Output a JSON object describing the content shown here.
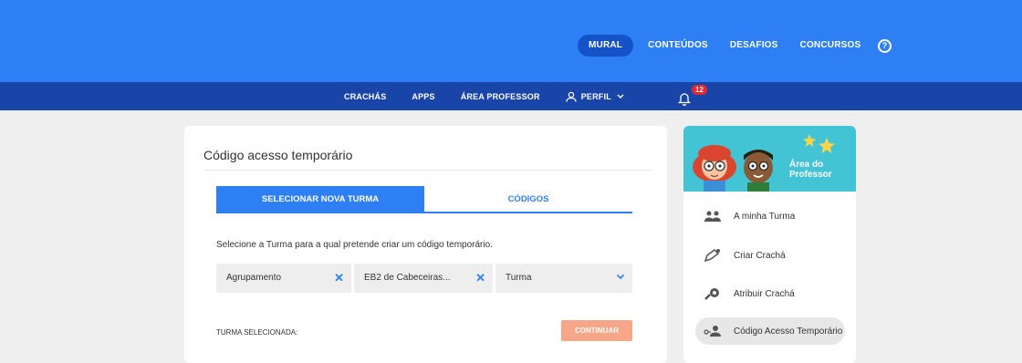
{
  "top_nav": {
    "items": [
      {
        "label": "MURAL",
        "active": true
      },
      {
        "label": "CONTEÚDOS",
        "active": false
      },
      {
        "label": "DESAFIOS",
        "active": false
      },
      {
        "label": "CONCURSOS",
        "active": false
      }
    ],
    "help_icon": "question-circle-icon"
  },
  "sub_nav": {
    "items": [
      {
        "label": "CRACHÁS"
      },
      {
        "label": "APPS"
      },
      {
        "label": "ÁREA PROFESSOR"
      }
    ],
    "profile_label": "PERFIL",
    "notifications_count": "12"
  },
  "main": {
    "title": "Código acesso temporário",
    "tabs": [
      {
        "label": "SELECIONAR NOVA TURMA",
        "active": true
      },
      {
        "label": "CÓDIGOS",
        "active": false
      }
    ],
    "description": "Selecione a Turma para a qual pretende criar um código temporário.",
    "fields": {
      "agrupamento": "Agrupamento",
      "escola": "EB2 de Cabeceiras...",
      "turma": "Turma"
    },
    "selected_label": "TURMA SELECIONADA:",
    "continue_label": "CONTINUAR"
  },
  "sidebar": {
    "header_title_line1": "Área do",
    "header_title_line2": "Professor",
    "items": [
      {
        "label": "A minha Turma",
        "icon": "group-icon",
        "active": false
      },
      {
        "label": "Criar Crachá",
        "icon": "pencil-badge-icon",
        "active": false
      },
      {
        "label": "Atribuir Crachá",
        "icon": "badge-award-icon",
        "active": false
      },
      {
        "label": "Código Acesso Temporário",
        "icon": "key-person-icon",
        "active": true
      }
    ]
  },
  "colors": {
    "primary_blue": "#2d7ff3",
    "dark_blue": "#1a45a8",
    "accent_orange": "#f7a687",
    "teal": "#42c4d4",
    "badge_red": "#e8272b"
  }
}
